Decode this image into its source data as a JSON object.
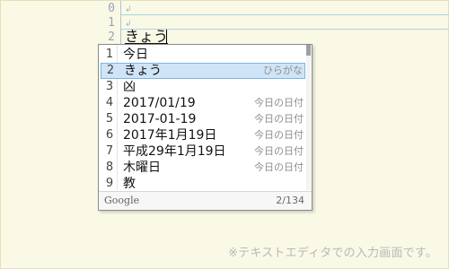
{
  "editor": {
    "line_numbers": [
      "0",
      "1",
      "2"
    ],
    "return_mark": "↲",
    "composition_text": "きょう"
  },
  "candidates": {
    "items": [
      {
        "num": "1",
        "word": "今日",
        "desc": ""
      },
      {
        "num": "2",
        "word": "きょう",
        "desc": "ひらがな"
      },
      {
        "num": "3",
        "word": "凶",
        "desc": ""
      },
      {
        "num": "4",
        "word": "2017/01/19",
        "desc": "今日の日付"
      },
      {
        "num": "5",
        "word": "2017-01-19",
        "desc": "今日の日付"
      },
      {
        "num": "6",
        "word": "2017年1月19日",
        "desc": "今日の日付"
      },
      {
        "num": "7",
        "word": "平成29年1月19日",
        "desc": "今日の日付"
      },
      {
        "num": "8",
        "word": "木曜日",
        "desc": "今日の日付"
      },
      {
        "num": "9",
        "word": "教",
        "desc": ""
      }
    ],
    "selected_index": 1,
    "footer": {
      "brand": "Google",
      "count": "2/134"
    }
  },
  "note": "※テキストエディタでの入力画面です。",
  "colors": {
    "background": "#faf9e6",
    "selection": "#cfe5f7",
    "selection_border": "#7fb4df",
    "line_rule": "#a8d5e0"
  }
}
